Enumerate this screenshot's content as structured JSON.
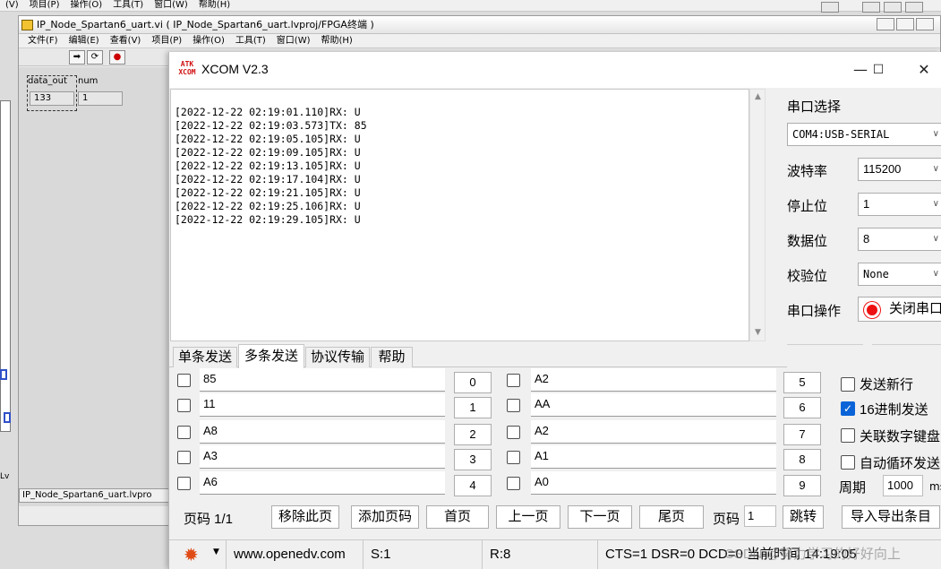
{
  "host": {
    "menu": [
      "(V)",
      "项目(P)",
      "操作(O)",
      "工具(T)",
      "窗口(W)",
      "帮助(H)"
    ]
  },
  "labview": {
    "title": "IP_Node_Spartan6_uart.vi ( IP_Node_Spartan6_uart.lvproj/FPGA终端 )",
    "menu": [
      "文件(F)",
      "编辑(E)",
      "查看(V)",
      "项目(P)",
      "操作(O)",
      "工具(T)",
      "窗口(W)",
      "帮助(H)"
    ],
    "indicators": {
      "data_out_label": "data_out",
      "data_out_value": "133",
      "num_label": "num",
      "num_value": "1"
    },
    "status_text": "IP_Node_Spartan6_uart.lvpro",
    "left_strip_text": "Lv"
  },
  "xcom": {
    "title": "XCOM V2.3",
    "logo": [
      "ATK",
      "XCOM"
    ],
    "controls": {
      "minimize": "—",
      "maximize": "☐",
      "close": "✕"
    },
    "rx_lines": [
      "[2022-12-22 02:19:01.110]RX: U",
      "[2022-12-22 02:19:03.573]TX: 85",
      "[2022-12-22 02:19:05.105]RX: U",
      "[2022-12-22 02:19:09.105]RX: U",
      "[2022-12-22 02:19:13.105]RX: U",
      "[2022-12-22 02:19:17.104]RX: U",
      "[2022-12-22 02:19:21.105]RX: U",
      "[2022-12-22 02:19:25.106]RX: U",
      "[2022-12-22 02:19:29.105]RX: U"
    ],
    "serial": {
      "port_select_label": "串口选择",
      "port_value": "COM4:USB-SERIAL",
      "baud_label": "波特率",
      "baud_value": "115200",
      "stop_label": "停止位",
      "stop_value": "1",
      "data_label": "数据位",
      "data_value": "8",
      "parity_label": "校验位",
      "parity_value": "None",
      "operation_label": "串口操作",
      "operation_button": "关闭串口"
    },
    "tabs": [
      "单条发送",
      "多条发送",
      "协议传输",
      "帮助"
    ],
    "active_tab": 1,
    "multi_send": {
      "left": [
        {
          "value": "85",
          "button": "0"
        },
        {
          "value": "11",
          "button": "1"
        },
        {
          "value": "A8",
          "button": "2"
        },
        {
          "value": "A3",
          "button": "3"
        },
        {
          "value": "A6",
          "button": "4"
        }
      ],
      "right": [
        {
          "value": "A2",
          "button": "5"
        },
        {
          "value": "AA",
          "button": "6"
        },
        {
          "value": "A2",
          "button": "7"
        },
        {
          "value": "A1",
          "button": "8"
        },
        {
          "value": "A0",
          "button": "9"
        }
      ]
    },
    "options": [
      {
        "label": "发送新行",
        "checked": false
      },
      {
        "label": "16进制发送",
        "checked": true
      },
      {
        "label": "关联数字键盘",
        "checked": false
      },
      {
        "label": "自动循环发送",
        "checked": false
      }
    ],
    "period": {
      "label": "周期",
      "value": "1000",
      "unit": "ms"
    },
    "pager": {
      "label": "页码 1/1",
      "remove": "移除此页",
      "add": "添加页码",
      "first": "首页",
      "prev": "上一页",
      "next": "下一页",
      "last": "尾页",
      "goto_label": "页码",
      "goto_value": "1",
      "jump": "跳转",
      "import_export": "导入导出条目"
    },
    "statusbar": {
      "website": "www.openedv.com",
      "sent": "S:1",
      "received": "R:8",
      "lines": "CTS=1 DSR=0 DCD=0 当前时间 14:19:05",
      "watermark": "CSDN @努力学习的好好向上"
    }
  }
}
